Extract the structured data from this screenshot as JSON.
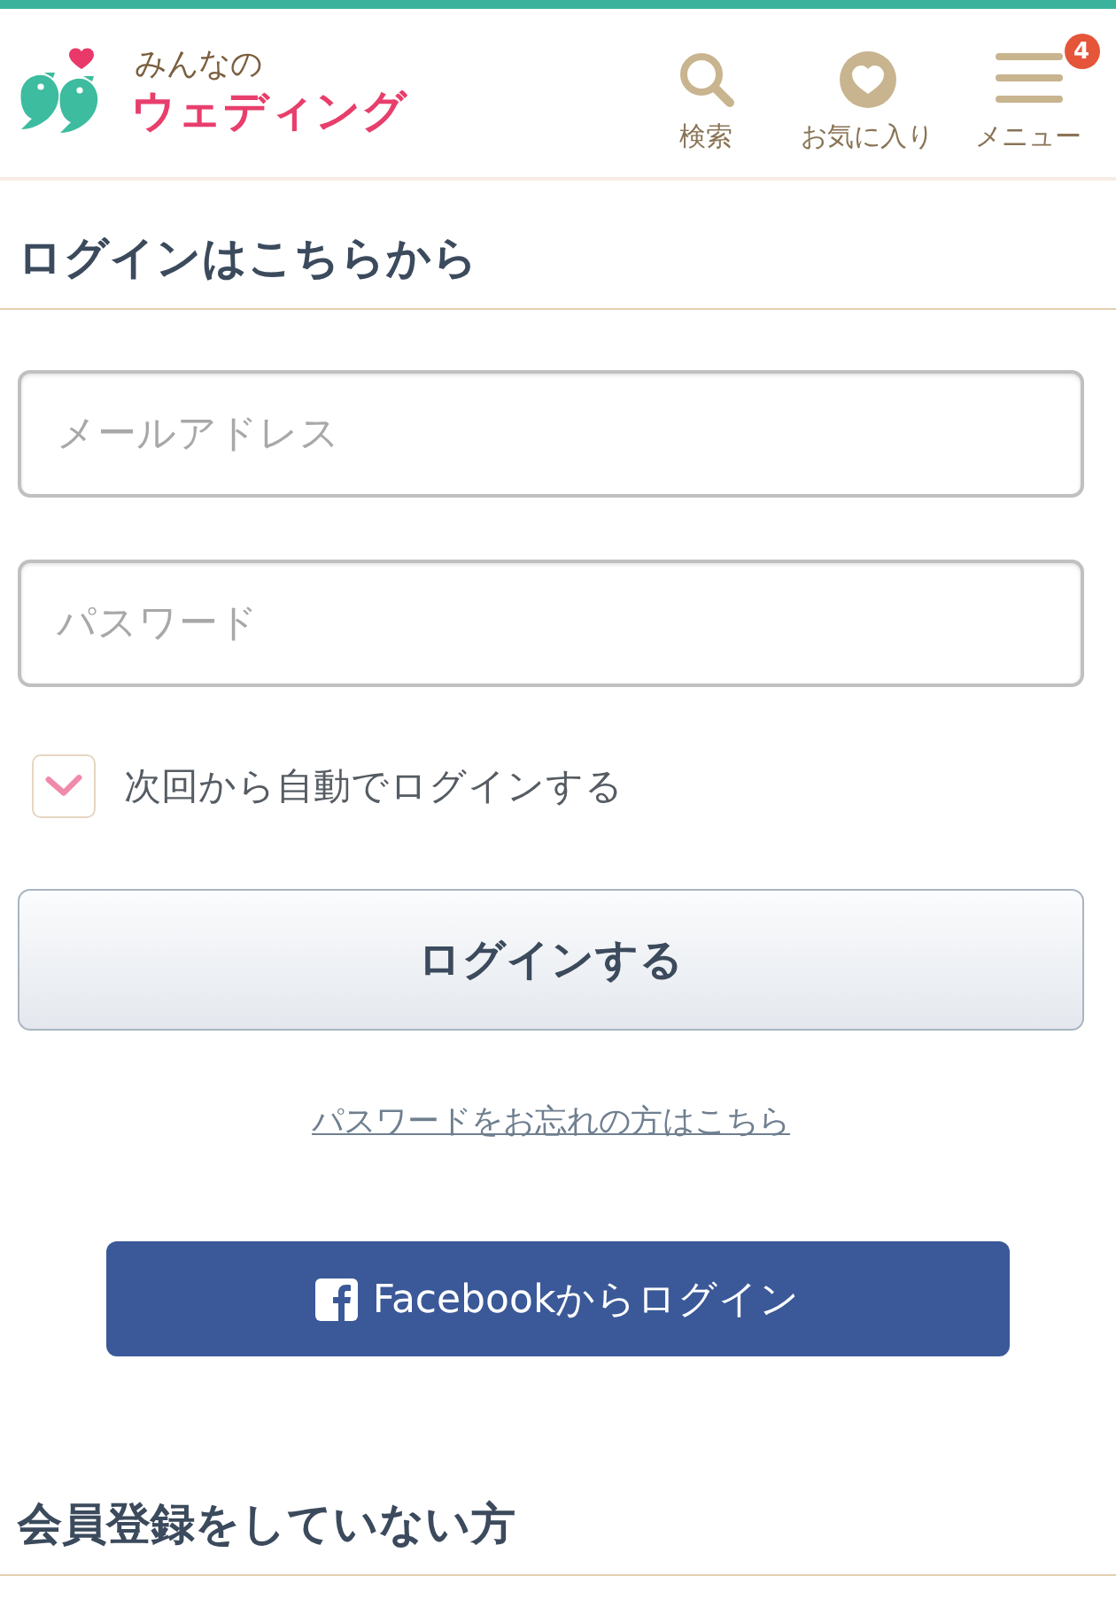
{
  "header": {
    "logo": {
      "tagline": "みんなの",
      "name": "ウェディング"
    },
    "nav": [
      {
        "kind": "search",
        "label": "検索"
      },
      {
        "kind": "favorite",
        "label": "お気に入り"
      },
      {
        "kind": "menu",
        "label": "メニュー",
        "badge": "4"
      }
    ]
  },
  "login": {
    "heading": "ログインはこちらから",
    "fields": [
      {
        "placeholder": "メールアドレス"
      },
      {
        "placeholder": "パスワード"
      }
    ],
    "remember": {
      "label": "次回から自動でログインする",
      "checked": true
    },
    "submit": "ログインする",
    "forgot_link": "パスワードをお忘れの方はこちら",
    "facebook_button": "Facebookからログイン"
  },
  "register": {
    "heading": "会員登録をしていない方"
  }
}
